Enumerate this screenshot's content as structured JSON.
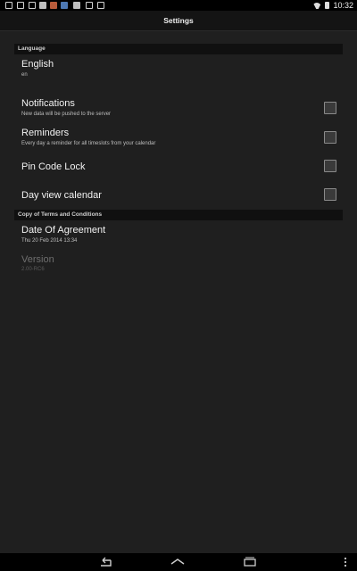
{
  "status_bar": {
    "time": "10:32",
    "icons": [
      "mail-icon",
      "gmail-icon",
      "notification-icon",
      "app-icon",
      "app-icon",
      "app-icon",
      "app-icon",
      "check-icon",
      "download-icon"
    ]
  },
  "header": {
    "title": "Settings"
  },
  "sections": {
    "language": {
      "header": "Language",
      "title": "English",
      "summary": "en"
    },
    "notifications": {
      "title": "Notifications",
      "summary": "New data will be pushed to the server",
      "checked": false
    },
    "reminders": {
      "title": "Reminders",
      "summary": "Every day a reminder for all timeslots from your calendar",
      "checked": false
    },
    "pin_code": {
      "title": "Pin Code Lock",
      "checked": false
    },
    "day_view": {
      "title": "Day view calendar",
      "checked": false
    },
    "terms": {
      "header": "Copy of Terms and Conditions",
      "title": "Date Of Agreement",
      "summary": "Thu 20 Feb 2014 13:34"
    },
    "version": {
      "title": "Version",
      "summary": "2.00-RC6"
    }
  },
  "colors": {
    "background": "#1f1f1f",
    "section_header_bg": "#101010",
    "text_primary": "#f2f2f2",
    "text_secondary": "#bdbdbd",
    "disabled": "#6e6e6e"
  }
}
